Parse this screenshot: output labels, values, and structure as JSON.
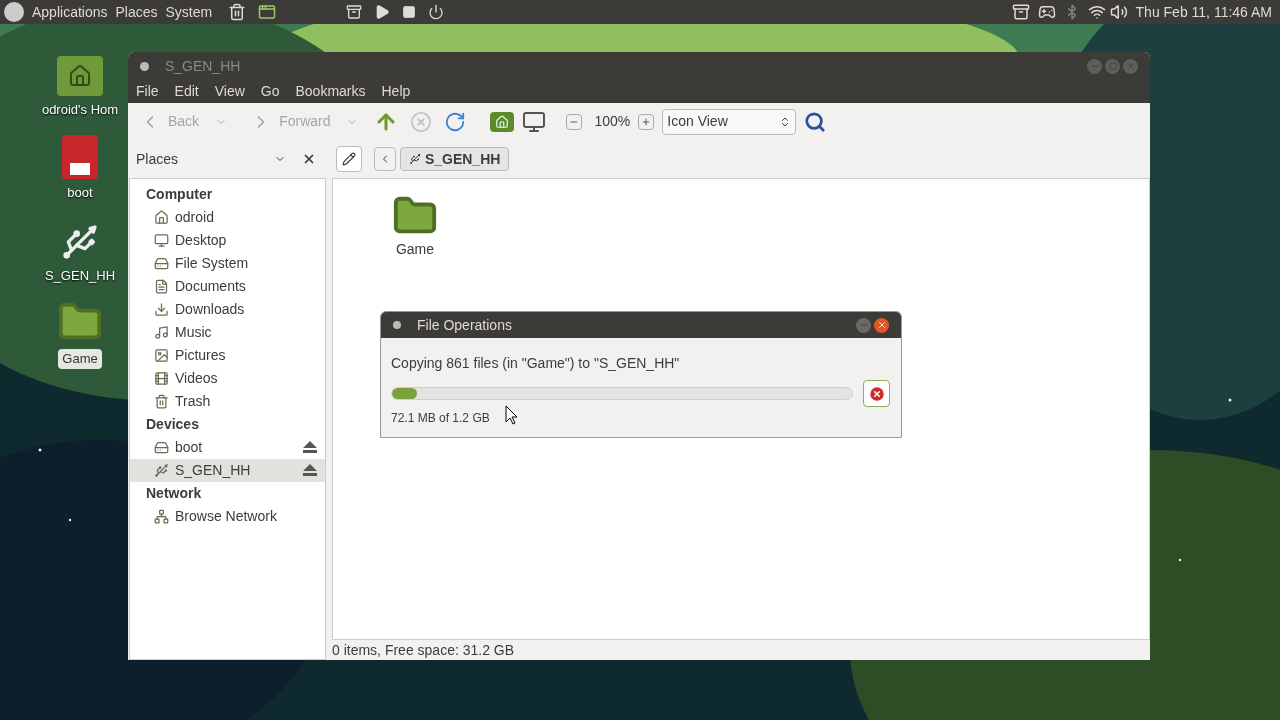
{
  "top_panel": {
    "menus": [
      "Applications",
      "Places",
      "System"
    ],
    "clock": "Thu Feb 11, 11:46 AM"
  },
  "desktop_icons": [
    {
      "label": "odroid's Hom",
      "kind": "home",
      "selected": false
    },
    {
      "label": "boot",
      "kind": "sd",
      "selected": false
    },
    {
      "label": "S_GEN_HH",
      "kind": "usb",
      "selected": false
    },
    {
      "label": "Game",
      "kind": "folder",
      "selected": true
    }
  ],
  "window": {
    "title": "S_GEN_HH",
    "menu": [
      "File",
      "Edit",
      "View",
      "Go",
      "Bookmarks",
      "Help"
    ],
    "toolbar": {
      "back": {
        "label": "Back",
        "disabled": true
      },
      "forward": {
        "label": "Forward",
        "disabled": true
      },
      "zoom": "100%",
      "view": "Icon View"
    },
    "sidebar": {
      "title": "Places",
      "sections": [
        {
          "title": "Computer",
          "items": [
            {
              "label": "odroid",
              "kind": "home",
              "selected": false,
              "eject": false
            },
            {
              "label": "Desktop",
              "kind": "desktop",
              "selected": false,
              "eject": false
            },
            {
              "label": "File System",
              "kind": "drive",
              "selected": false,
              "eject": false
            },
            {
              "label": "Documents",
              "kind": "documents",
              "selected": false,
              "eject": false
            },
            {
              "label": "Downloads",
              "kind": "downloads",
              "selected": false,
              "eject": false
            },
            {
              "label": "Music",
              "kind": "music",
              "selected": false,
              "eject": false
            },
            {
              "label": "Pictures",
              "kind": "pictures",
              "selected": false,
              "eject": false
            },
            {
              "label": "Videos",
              "kind": "videos",
              "selected": false,
              "eject": false
            },
            {
              "label": "Trash",
              "kind": "trash",
              "selected": false,
              "eject": false
            }
          ]
        },
        {
          "title": "Devices",
          "items": [
            {
              "label": "boot",
              "kind": "disk",
              "selected": false,
              "eject": true
            },
            {
              "label": "S_GEN_HH",
              "kind": "usb",
              "selected": true,
              "eject": true
            }
          ]
        },
        {
          "title": "Network",
          "items": [
            {
              "label": "Browse Network",
              "kind": "network",
              "selected": false,
              "eject": false
            }
          ]
        }
      ]
    },
    "path": "S_GEN_HH",
    "files": [
      {
        "label": "Game"
      }
    ],
    "status": "0 items, Free space: 31.2 GB"
  },
  "dialog": {
    "title": "File Operations",
    "message": "Copying 861 files (in \"Game\") to \"S_GEN_HH\"",
    "level": 0.055,
    "detail": "72.1 MB of 1.2 GB"
  }
}
